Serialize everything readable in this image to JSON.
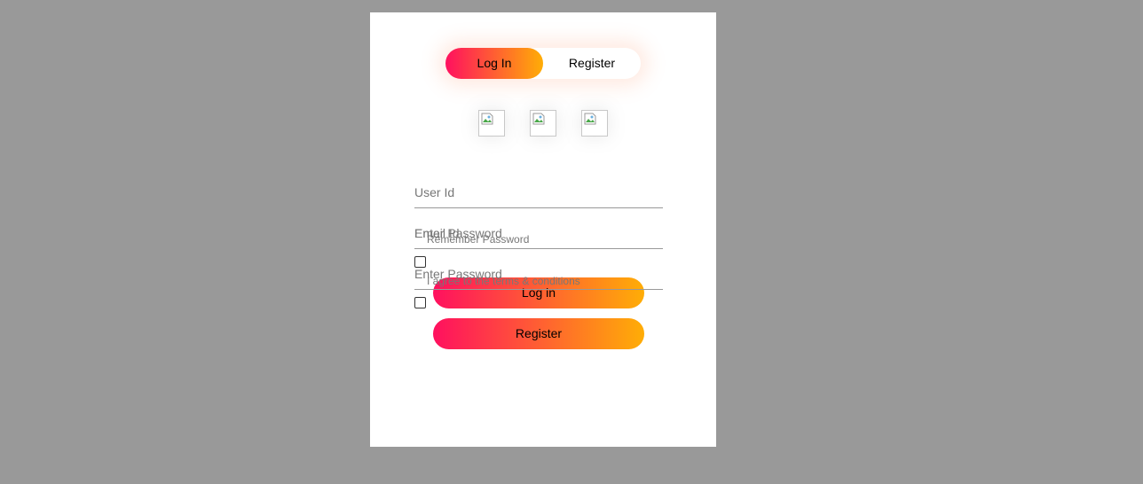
{
  "toggle": {
    "login_label": "Log In",
    "register_label": "Register"
  },
  "social_icons": [
    {
      "name": "broken-image-icon"
    },
    {
      "name": "broken-image-icon"
    },
    {
      "name": "broken-image-icon"
    }
  ],
  "login_form": {
    "user_id_placeholder": "User Id",
    "password_placeholder": "Enter Password",
    "remember_label": "Remember Password",
    "submit_label": "Log in"
  },
  "register_form": {
    "user_id_placeholder": "User Id",
    "email_placeholder": "Email Id",
    "password_placeholder": "Enter Password",
    "terms_label": "I agree to the terms & conditions",
    "submit_label": "Register"
  },
  "colors": {
    "page_background": "#999999",
    "card_background": "#ffffff",
    "gradient_start": "#ff105f",
    "gradient_end": "#ffad06"
  }
}
